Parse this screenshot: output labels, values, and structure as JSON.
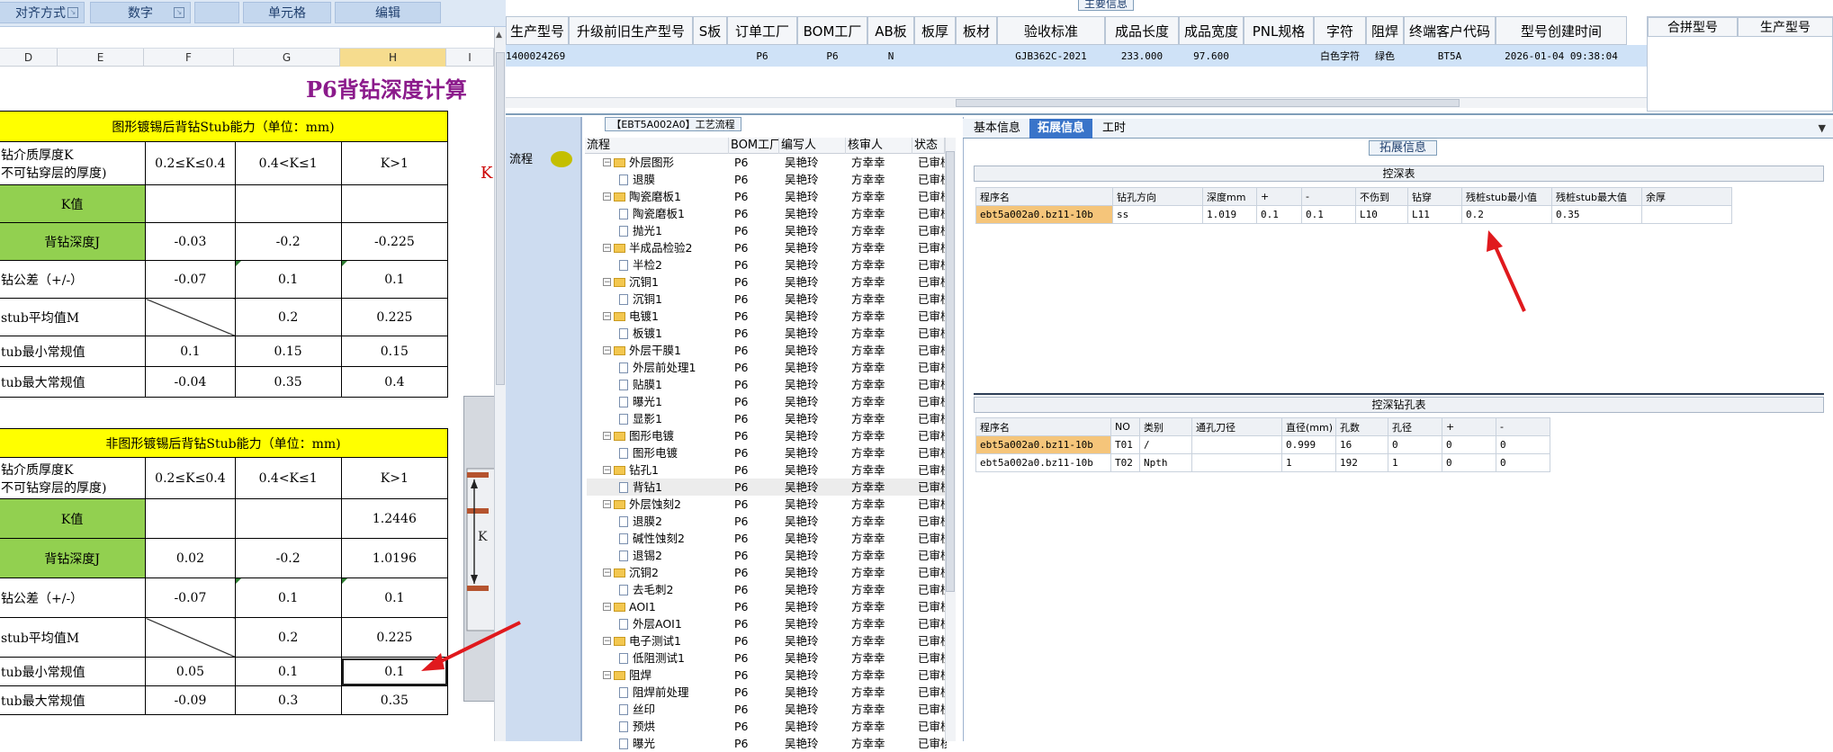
{
  "ribbon": {
    "groups": [
      "对齐方式",
      "数字",
      "",
      "单元格",
      "编辑"
    ]
  },
  "sheet": {
    "col_headers": [
      "D",
      "E",
      "F",
      "G",
      "H",
      "I"
    ],
    "title": "P6背钻深度计算",
    "red_k": "K",
    "table1": {
      "header": "图形镀锡后背钻Stub能力（单位：mm)",
      "thickness_label_1": "钻介质厚度K",
      "thickness_label_2": "不可钻穿层的厚度)",
      "ranges": [
        "0.2≤K≤0.4",
        "0.4<K≤1",
        "K>1"
      ],
      "rows": [
        {
          "label": "K值",
          "values": [
            "",
            "",
            ""
          ]
        },
        {
          "label": "背钻深度J",
          "values": [
            "-0.03",
            "-0.2",
            "-0.225"
          ]
        },
        {
          "label": "钻公差（+/-）",
          "values": [
            "-0.07",
            "0.1",
            "0.1"
          ]
        },
        {
          "label": "stub平均值M",
          "values": [
            "",
            "0.2",
            "0.225"
          ]
        },
        {
          "label": "tub最小常规值",
          "values": [
            "0.1",
            "0.15",
            "0.15"
          ]
        },
        {
          "label": "tub最大常规值",
          "values": [
            "-0.04",
            "0.35",
            "0.4"
          ]
        }
      ]
    },
    "table2": {
      "header": "非图形镀锡后背钻Stub能力（单位：mm)",
      "thickness_label_1": "钻介质厚度K",
      "thickness_label_2": "不可钻穿层的厚度)",
      "ranges": [
        "0.2≤K≤0.4",
        "0.4<K≤1",
        "K>1"
      ],
      "rows": [
        {
          "label": "K值",
          "values": [
            "",
            "",
            "1.2446"
          ]
        },
        {
          "label": "背钻深度J",
          "values": [
            "0.02",
            "-0.2",
            "1.0196"
          ]
        },
        {
          "label": "钻公差（+/-）",
          "values": [
            "-0.07",
            "0.1",
            "0.1"
          ]
        },
        {
          "label": "stub平均值M",
          "values": [
            "",
            "0.2",
            "0.225"
          ]
        },
        {
          "label": "tub最小常规值",
          "values": [
            "0.05",
            "0.1",
            "0.1"
          ]
        },
        {
          "label": "tub最大常规值",
          "values": [
            "-0.09",
            "0.3",
            "0.35"
          ]
        }
      ]
    },
    "diagram_label": "K"
  },
  "main_info": {
    "title": "主要信息",
    "headers": [
      "生产型号",
      "升级前旧生产型号",
      "S板",
      "订单工厂",
      "BOM工厂",
      "AB板",
      "板厚",
      "板材",
      "验收标准",
      "成品长度",
      "成品宽度",
      "PNL规格",
      "字符",
      "阻焊",
      "终端客户代码",
      "型号创建时间"
    ],
    "row": [
      "1400024269",
      "",
      "",
      "P6",
      "P6",
      "N",
      "",
      "",
      "GJB362C-2021",
      "233.000",
      "97.600",
      "",
      "白色字符",
      "绿色",
      "BT5A",
      "2026-01-04 09:38:04"
    ],
    "right_headers": [
      "合拼型号",
      "生产型号"
    ]
  },
  "flow": {
    "left_label": "流程",
    "title": "【EBT5A002A0】工艺流程",
    "headers": [
      "流程",
      "BOM工厂",
      "编写人",
      "核审人",
      "状态"
    ],
    "rows": [
      {
        "name": "外层图形",
        "level": 1,
        "type": "folder",
        "f": "P6",
        "w": "吴艳玲",
        "r": "方幸幸",
        "s": "已审核"
      },
      {
        "name": "退膜",
        "level": 2,
        "type": "doc",
        "f": "P6",
        "w": "吴艳玲",
        "r": "方幸幸",
        "s": "已审核"
      },
      {
        "name": "陶瓷磨板1",
        "level": 1,
        "type": "folder",
        "f": "P6",
        "w": "吴艳玲",
        "r": "方幸幸",
        "s": "已审核"
      },
      {
        "name": "陶瓷磨板1",
        "level": 2,
        "type": "doc",
        "f": "P6",
        "w": "吴艳玲",
        "r": "方幸幸",
        "s": "已审核"
      },
      {
        "name": "抛光1",
        "level": 2,
        "type": "doc",
        "f": "P6",
        "w": "吴艳玲",
        "r": "方幸幸",
        "s": "已审核"
      },
      {
        "name": "半成品检验2",
        "level": 1,
        "type": "folder",
        "f": "P6",
        "w": "吴艳玲",
        "r": "方幸幸",
        "s": "已审核"
      },
      {
        "name": "半检2",
        "level": 2,
        "type": "doc",
        "f": "P6",
        "w": "吴艳玲",
        "r": "方幸幸",
        "s": "已审核"
      },
      {
        "name": "沉铜1",
        "level": 1,
        "type": "folder",
        "f": "P6",
        "w": "吴艳玲",
        "r": "方幸幸",
        "s": "已审核"
      },
      {
        "name": "沉铜1",
        "level": 2,
        "type": "doc",
        "f": "P6",
        "w": "吴艳玲",
        "r": "方幸幸",
        "s": "已审核"
      },
      {
        "name": "电镀1",
        "level": 1,
        "type": "folder",
        "f": "P6",
        "w": "吴艳玲",
        "r": "方幸幸",
        "s": "已审核"
      },
      {
        "name": "板镀1",
        "level": 2,
        "type": "doc",
        "f": "P6",
        "w": "吴艳玲",
        "r": "方幸幸",
        "s": "已审核"
      },
      {
        "name": "外层干膜1",
        "level": 1,
        "type": "folder",
        "f": "P6",
        "w": "吴艳玲",
        "r": "方幸幸",
        "s": "已审核"
      },
      {
        "name": "外层前处理1",
        "level": 2,
        "type": "doc",
        "f": "P6",
        "w": "吴艳玲",
        "r": "方幸幸",
        "s": "已审核"
      },
      {
        "name": "贴膜1",
        "level": 2,
        "type": "doc",
        "f": "P6",
        "w": "吴艳玲",
        "r": "方幸幸",
        "s": "已审核"
      },
      {
        "name": "曝光1",
        "level": 2,
        "type": "doc",
        "f": "P6",
        "w": "吴艳玲",
        "r": "方幸幸",
        "s": "已审核"
      },
      {
        "name": "显影1",
        "level": 2,
        "type": "doc",
        "f": "P6",
        "w": "吴艳玲",
        "r": "方幸幸",
        "s": "已审核"
      },
      {
        "name": "图形电镀",
        "level": 1,
        "type": "folder",
        "f": "P6",
        "w": "吴艳玲",
        "r": "方幸幸",
        "s": "已审核"
      },
      {
        "name": "图形电镀",
        "level": 2,
        "type": "doc",
        "f": "P6",
        "w": "吴艳玲",
        "r": "方幸幸",
        "s": "已审核"
      },
      {
        "name": "钻孔1",
        "level": 1,
        "type": "folder",
        "f": "P6",
        "w": "吴艳玲",
        "r": "方幸幸",
        "s": "已审核"
      },
      {
        "name": "背钻1",
        "level": 2,
        "type": "doc",
        "f": "P6",
        "w": "吴艳玲",
        "r": "方幸幸",
        "s": "已审核",
        "selected": true
      },
      {
        "name": "外层蚀刻2",
        "level": 1,
        "type": "folder",
        "f": "P6",
        "w": "吴艳玲",
        "r": "方幸幸",
        "s": "已审核"
      },
      {
        "name": "退膜2",
        "level": 2,
        "type": "doc",
        "f": "P6",
        "w": "吴艳玲",
        "r": "方幸幸",
        "s": "已审核"
      },
      {
        "name": "碱性蚀刻2",
        "level": 2,
        "type": "doc",
        "f": "P6",
        "w": "吴艳玲",
        "r": "方幸幸",
        "s": "已审核"
      },
      {
        "name": "退锡2",
        "level": 2,
        "type": "doc",
        "f": "P6",
        "w": "吴艳玲",
        "r": "方幸幸",
        "s": "已审核"
      },
      {
        "name": "沉铜2",
        "level": 1,
        "type": "folder",
        "f": "P6",
        "w": "吴艳玲",
        "r": "方幸幸",
        "s": "已审核"
      },
      {
        "name": "去毛刺2",
        "level": 2,
        "type": "doc",
        "f": "P6",
        "w": "吴艳玲",
        "r": "方幸幸",
        "s": "已审核"
      },
      {
        "name": "AOI1",
        "level": 1,
        "type": "folder",
        "f": "P6",
        "w": "吴艳玲",
        "r": "方幸幸",
        "s": "已审核"
      },
      {
        "name": "外层AOI1",
        "level": 2,
        "type": "doc",
        "f": "P6",
        "w": "吴艳玲",
        "r": "方幸幸",
        "s": "已审核"
      },
      {
        "name": "电子测试1",
        "level": 1,
        "type": "folder",
        "f": "P6",
        "w": "吴艳玲",
        "r": "方幸幸",
        "s": "已审核"
      },
      {
        "name": "低阻测试1",
        "level": 2,
        "type": "doc",
        "f": "P6",
        "w": "吴艳玲",
        "r": "方幸幸",
        "s": "已审核"
      },
      {
        "name": "阻焊",
        "level": 1,
        "type": "folder",
        "f": "P6",
        "w": "吴艳玲",
        "r": "方幸幸",
        "s": "已审核"
      },
      {
        "name": "阻焊前处理",
        "level": 2,
        "type": "doc",
        "f": "P6",
        "w": "吴艳玲",
        "r": "方幸幸",
        "s": "已审核"
      },
      {
        "name": "丝印",
        "level": 2,
        "type": "doc",
        "f": "P6",
        "w": "吴艳玲",
        "r": "方幸幸",
        "s": "已审核"
      },
      {
        "name": "预烘",
        "level": 2,
        "type": "doc",
        "f": "P6",
        "w": "吴艳玲",
        "r": "方幸幸",
        "s": "已审核"
      },
      {
        "name": "曝光",
        "level": 2,
        "type": "doc",
        "f": "P6",
        "w": "吴艳玲",
        "r": "方幸幸",
        "s": "已审核"
      }
    ]
  },
  "ext": {
    "tabs": [
      "基本信息",
      "拓展信息",
      "工时"
    ],
    "active_tab": 1,
    "title": "拓展信息",
    "depth_table": {
      "title": "控深表",
      "headers": [
        "程序名",
        "钻孔方向",
        "深度mm",
        "+",
        "-",
        "不伤到",
        "钻穿",
        "残桩stub最小值",
        "残桩stub最大值",
        "余厚"
      ],
      "rows": [
        [
          "ebt5a002a0.bz11-10b",
          "ss",
          "1.019",
          "0.1",
          "0.1",
          "L10",
          "L11",
          "0.2",
          "0.35",
          ""
        ]
      ]
    },
    "hole_table": {
      "title": "控深钻孔表",
      "headers": [
        "程序名",
        "NO",
        "类别",
        "通孔刀径",
        "直径(mm)",
        "孔数",
        "孔径",
        "+",
        "-"
      ],
      "rows": [
        [
          "ebt5a002a0.bz11-10b",
          "T01",
          "/",
          "",
          "0.999",
          "16",
          "0",
          "0",
          "0"
        ],
        [
          "ebt5a002a0.bz11-10b",
          "T02",
          "Npth",
          "",
          "1",
          "192",
          "1",
          "0",
          "0"
        ]
      ]
    }
  },
  "colors": {
    "yellow_header": "#ffff00",
    "green_label": "#92d050",
    "title_purple": "#8b1a8b",
    "active_tab": "#3974c9",
    "selected_row": "#cfe2f7",
    "orange_cell": "#f5c57a",
    "annotation_arrow": "#e0191d"
  }
}
